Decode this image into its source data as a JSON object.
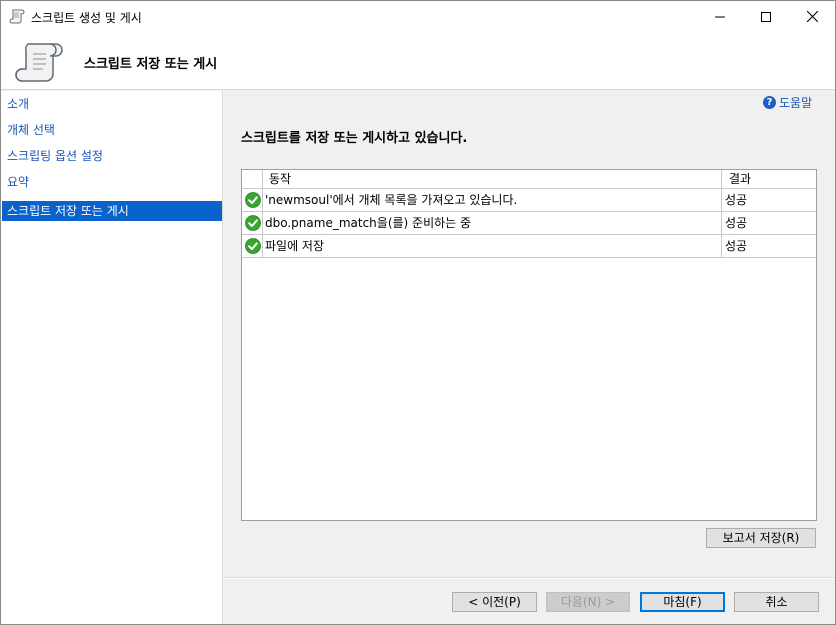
{
  "window": {
    "title": "스크립트 생성 및 게시",
    "icon": "script-scroll-icon"
  },
  "banner": {
    "title": "스크립트 저장 또는 게시",
    "icon": "script-scroll-icon"
  },
  "sidebar": {
    "items": [
      {
        "label": "소개",
        "active": false
      },
      {
        "label": "개체 선택",
        "active": false
      },
      {
        "label": "스크립팅 옵션 설정",
        "active": false
      },
      {
        "label": "요약",
        "active": false
      },
      {
        "label": "스크립트 저장 또는 게시",
        "active": true
      }
    ]
  },
  "help": {
    "label": "도움말",
    "icon": "help-icon"
  },
  "main": {
    "heading": "스크립트를 저장 또는 게시하고 있습니다.",
    "columns": {
      "action": "동작",
      "result": "결과"
    },
    "rows": [
      {
        "status_icon": "success-check-icon",
        "action": "'newmsoul'에서 개체 목록을 가져오고 있습니다.",
        "result": "성공"
      },
      {
        "status_icon": "success-check-icon",
        "action": "dbo.pname_match을(를) 준비하는 중",
        "result": "성공"
      },
      {
        "status_icon": "success-check-icon",
        "action": "파일에 저장",
        "result": "성공"
      }
    ],
    "save_report_label": "보고서 저장(R)"
  },
  "footer": {
    "prev_label": "< 이전(P)",
    "next_label": "다음(N) >",
    "finish_label": "마침(F)",
    "cancel_label": "취소"
  },
  "colors": {
    "accent": "#0a62cc",
    "link": "#1a56b8",
    "success": "#3aa535"
  }
}
